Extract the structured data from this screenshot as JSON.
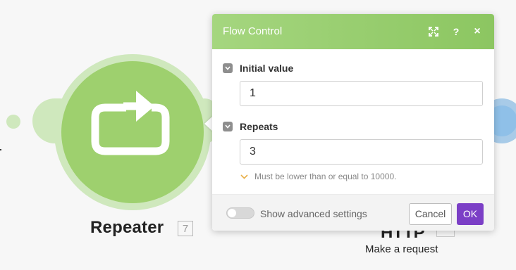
{
  "module": {
    "name": "Repeater",
    "count": "7",
    "icon": "repeat-icon",
    "color": "#9ed06e"
  },
  "next_module": {
    "title": "HTTP",
    "label": "Make a request"
  },
  "dialog": {
    "title": "Flow Control",
    "header_color": "#8cc661",
    "buttons": {
      "expand_icon": "expand-icon",
      "help_label": "?",
      "close_label": "×"
    },
    "fields": [
      {
        "label": "Initial value",
        "value": "1"
      },
      {
        "label": "Repeats",
        "value": "3",
        "hint": "Must be lower than or equal to 10000."
      }
    ],
    "advanced_label": "Show advanced settings",
    "advanced_enabled": false,
    "cancel_label": "Cancel",
    "ok_label": "OK",
    "ok_color": "#7b3fc6"
  }
}
